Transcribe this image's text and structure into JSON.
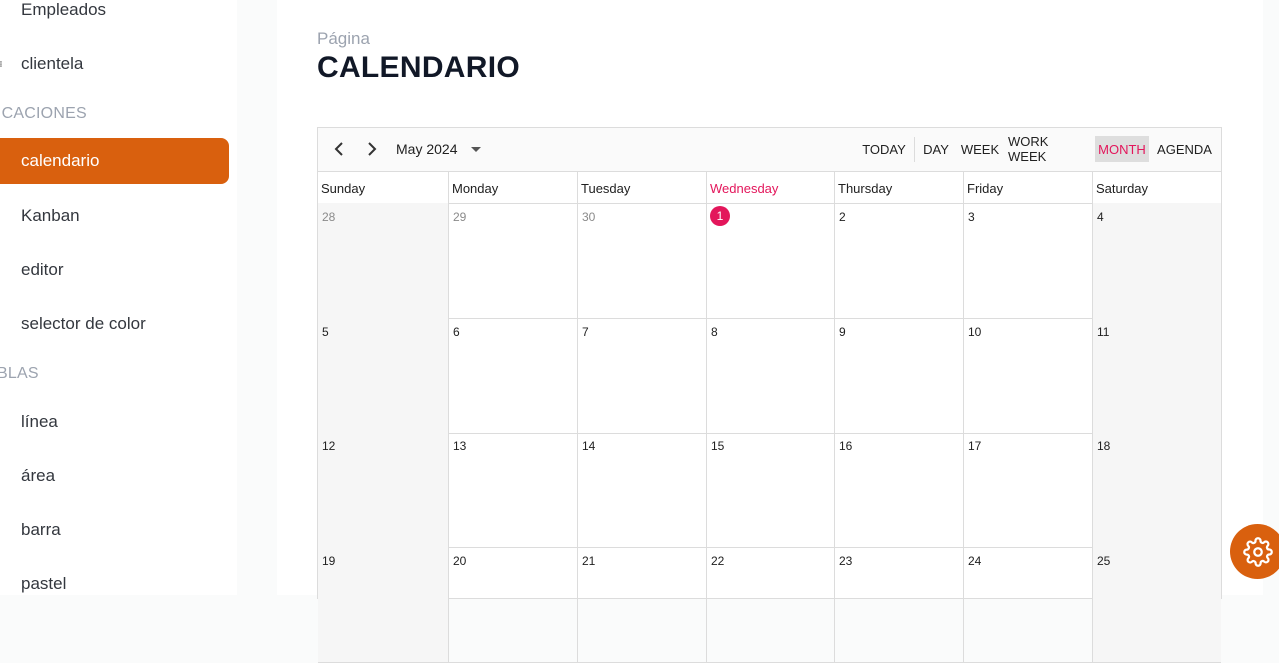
{
  "sidebar": {
    "items": [
      {
        "label": "Empleados",
        "icon": "users-icon"
      },
      {
        "label": "clientela",
        "icon": "list-icon"
      },
      {
        "label": "calendario",
        "icon": "calendar-icon"
      },
      {
        "label": "Kanban",
        "icon": "kanban-icon"
      },
      {
        "label": "editor",
        "icon": "pen-icon"
      },
      {
        "label": "selector de color",
        "icon": "palette-icon"
      },
      {
        "label": "línea",
        "icon": "line-chart-icon"
      },
      {
        "label": "área",
        "icon": "area-chart-icon"
      },
      {
        "label": "barra",
        "icon": "bar-chart-icon"
      },
      {
        "label": "pastel",
        "icon": "pie-chart-icon"
      }
    ],
    "sections": {
      "apps": "ICACIONES",
      "charts": "BLAS"
    }
  },
  "page": {
    "subtitle": "Página",
    "title": "CALENDARIO"
  },
  "calendar": {
    "date_range": "May 2024",
    "views": {
      "today": "TODAY",
      "day": "DAY",
      "week": "WEEK",
      "work_week": "WORK WEEK",
      "month": "MONTH",
      "agenda": "AGENDA"
    },
    "active_view": "MONTH",
    "weekdays": [
      "Sunday",
      "Monday",
      "Tuesday",
      "Wednesday",
      "Thursday",
      "Friday",
      "Saturday"
    ],
    "today_weekday": "Wednesday",
    "weeks": [
      [
        "28",
        "29",
        "30",
        "1",
        "2",
        "3",
        "4"
      ],
      [
        "5",
        "6",
        "7",
        "8",
        "9",
        "10",
        "11"
      ],
      [
        "12",
        "13",
        "14",
        "15",
        "16",
        "17",
        "18"
      ],
      [
        "19",
        "20",
        "21",
        "22",
        "23",
        "24",
        "25"
      ]
    ],
    "today_date": "1",
    "colors": {
      "accent": "#d9600e",
      "today": "#e3165b"
    }
  }
}
